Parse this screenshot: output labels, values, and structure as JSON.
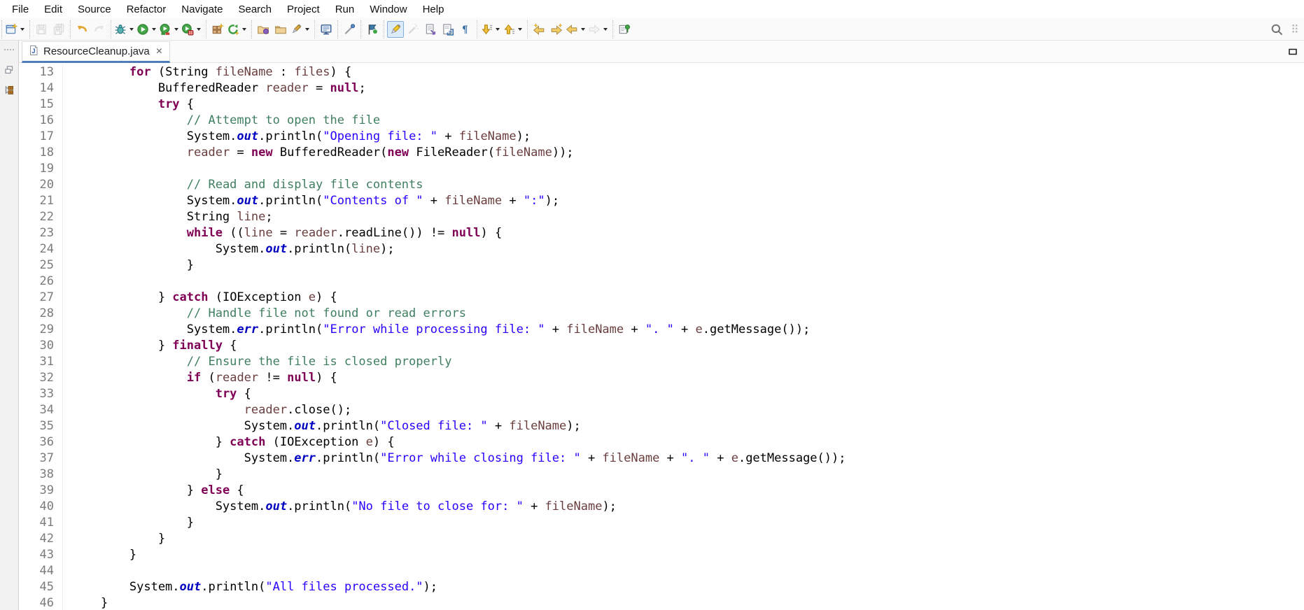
{
  "menubar": {
    "items": [
      {
        "label": "File"
      },
      {
        "label": "Edit"
      },
      {
        "label": "Source"
      },
      {
        "label": "Refactor"
      },
      {
        "label": "Navigate"
      },
      {
        "label": "Search"
      },
      {
        "label": "Project"
      },
      {
        "label": "Run"
      },
      {
        "label": "Window"
      },
      {
        "label": "Help"
      }
    ]
  },
  "toolbar": {
    "groups": [
      {
        "buttons": [
          {
            "name": "new-wizard",
            "icon": "new",
            "dd": true
          }
        ]
      },
      {
        "buttons": [
          {
            "name": "save",
            "icon": "save",
            "disabled": true
          },
          {
            "name": "save-all",
            "icon": "saveall",
            "disabled": true
          }
        ]
      },
      {
        "buttons": [
          {
            "name": "undo",
            "icon": "undo"
          },
          {
            "name": "redo",
            "icon": "redo",
            "disabled": true
          }
        ]
      },
      {
        "buttons": [
          {
            "name": "debug",
            "icon": "bug",
            "dd": true
          },
          {
            "name": "run",
            "icon": "play",
            "dd": true
          },
          {
            "name": "coverage",
            "icon": "cov",
            "dd": true
          },
          {
            "name": "profile",
            "icon": "prof",
            "dd": true
          }
        ]
      },
      {
        "buttons": [
          {
            "name": "new-java-project",
            "icon": "grid"
          },
          {
            "name": "run-last-tool",
            "icon": "refreshstar",
            "dd": true
          }
        ]
      },
      {
        "buttons": [
          {
            "name": "import-wizard",
            "icon": "folderp"
          },
          {
            "name": "open-resource",
            "icon": "folder"
          },
          {
            "name": "external-tools",
            "icon": "marker",
            "dd": true
          }
        ]
      },
      {
        "buttons": [
          {
            "name": "open-console",
            "icon": "monitor"
          }
        ]
      },
      {
        "buttons": [
          {
            "name": "inspect",
            "icon": "wand"
          }
        ]
      },
      {
        "buttons": [
          {
            "name": "next-task",
            "icon": "flag"
          }
        ]
      },
      {
        "buttons": [
          {
            "name": "mark-occurrences",
            "icon": "highlighter",
            "active": true
          },
          {
            "name": "content-assist",
            "icon": "pen2",
            "disabled": true
          },
          {
            "name": "open-task",
            "icon": "docarrow"
          },
          {
            "name": "show-source",
            "icon": "docframe"
          },
          {
            "name": "show-whitespace",
            "icon": "pilcrow"
          }
        ]
      },
      {
        "buttons": [
          {
            "name": "next-annotation",
            "icon": "arrdown",
            "dd": true
          },
          {
            "name": "previous-annotation",
            "icon": "arrup",
            "dd": true
          }
        ]
      },
      {
        "buttons": [
          {
            "name": "last-edit-location",
            "icon": "arrleftstar"
          },
          {
            "name": "next-edit-location",
            "icon": "arrrightstar"
          },
          {
            "name": "back",
            "icon": "arrleft",
            "dd": true
          },
          {
            "name": "forward",
            "icon": "arrright",
            "dd": true,
            "disabled": true
          }
        ]
      },
      {
        "buttons": [
          {
            "name": "pin-editor",
            "icon": "pin"
          }
        ]
      }
    ],
    "right": [
      {
        "name": "search",
        "icon": "search"
      },
      {
        "name": "toolbar-overflow",
        "icon": "dots"
      }
    ]
  },
  "left_rail": {
    "items": [
      {
        "name": "toolbar-handle",
        "icon": "raildots",
        "interactable": false
      },
      {
        "name": "restore-view",
        "icon": "railrestore",
        "interactable": true
      },
      {
        "name": "package-explorer",
        "icon": "railpackage",
        "interactable": true
      }
    ]
  },
  "editor": {
    "tab": {
      "label": "ResourceCleanup.java",
      "close_glyph": "×"
    },
    "colors": {
      "keyword": "#7f0055",
      "string": "#2a00ff",
      "comment": "#3f7f5f",
      "static_field": "#0000c0",
      "variable": "#6a3e3e",
      "plain": "#000000",
      "line_number": "#7b7b7b",
      "tab_underline": "#4f7cbe"
    },
    "code": {
      "language": "java",
      "lines": [
        {
          "n": 13,
          "tokens": [
            [
              "p",
              "        "
            ],
            [
              "k",
              "for"
            ],
            [
              "p",
              " (String "
            ],
            [
              "v",
              "fileName"
            ],
            [
              "p",
              " : "
            ],
            [
              "v",
              "files"
            ],
            [
              "p",
              ") {"
            ]
          ]
        },
        {
          "n": 14,
          "tokens": [
            [
              "p",
              "            BufferedReader "
            ],
            [
              "v",
              "reader"
            ],
            [
              "p",
              " = "
            ],
            [
              "k",
              "null"
            ],
            [
              "p",
              ";"
            ]
          ]
        },
        {
          "n": 15,
          "tokens": [
            [
              "p",
              "            "
            ],
            [
              "k",
              "try"
            ],
            [
              "p",
              " {"
            ]
          ]
        },
        {
          "n": 16,
          "tokens": [
            [
              "p",
              "                "
            ],
            [
              "c",
              "// Attempt to open the file"
            ]
          ]
        },
        {
          "n": 17,
          "tokens": [
            [
              "p",
              "                System."
            ],
            [
              "f",
              "out"
            ],
            [
              "p",
              ".println("
            ],
            [
              "s",
              "\"Opening file: \""
            ],
            [
              "p",
              " + "
            ],
            [
              "v",
              "fileName"
            ],
            [
              "p",
              ");"
            ]
          ]
        },
        {
          "n": 18,
          "tokens": [
            [
              "p",
              "                "
            ],
            [
              "v",
              "reader"
            ],
            [
              "p",
              " = "
            ],
            [
              "k",
              "new"
            ],
            [
              "p",
              " BufferedReader("
            ],
            [
              "k",
              "new"
            ],
            [
              "p",
              " FileReader("
            ],
            [
              "v",
              "fileName"
            ],
            [
              "p",
              "));"
            ]
          ]
        },
        {
          "n": 19,
          "tokens": []
        },
        {
          "n": 20,
          "tokens": [
            [
              "p",
              "                "
            ],
            [
              "c",
              "// Read and display file contents"
            ]
          ]
        },
        {
          "n": 21,
          "tokens": [
            [
              "p",
              "                System."
            ],
            [
              "f",
              "out"
            ],
            [
              "p",
              ".println("
            ],
            [
              "s",
              "\"Contents of \""
            ],
            [
              "p",
              " + "
            ],
            [
              "v",
              "fileName"
            ],
            [
              "p",
              " + "
            ],
            [
              "s",
              "\":\""
            ],
            [
              "p",
              ");"
            ]
          ]
        },
        {
          "n": 22,
          "tokens": [
            [
              "p",
              "                String "
            ],
            [
              "v",
              "line"
            ],
            [
              "p",
              ";"
            ]
          ]
        },
        {
          "n": 23,
          "tokens": [
            [
              "p",
              "                "
            ],
            [
              "k",
              "while"
            ],
            [
              "p",
              " (("
            ],
            [
              "v",
              "line"
            ],
            [
              "p",
              " = "
            ],
            [
              "v",
              "reader"
            ],
            [
              "p",
              ".readLine()) != "
            ],
            [
              "k",
              "null"
            ],
            [
              "p",
              ") {"
            ]
          ]
        },
        {
          "n": 24,
          "tokens": [
            [
              "p",
              "                    System."
            ],
            [
              "f",
              "out"
            ],
            [
              "p",
              ".println("
            ],
            [
              "v",
              "line"
            ],
            [
              "p",
              ");"
            ]
          ]
        },
        {
          "n": 25,
          "tokens": [
            [
              "p",
              "                }"
            ]
          ]
        },
        {
          "n": 26,
          "tokens": []
        },
        {
          "n": 27,
          "tokens": [
            [
              "p",
              "            } "
            ],
            [
              "k",
              "catch"
            ],
            [
              "p",
              " (IOException "
            ],
            [
              "v",
              "e"
            ],
            [
              "p",
              ") {"
            ]
          ]
        },
        {
          "n": 28,
          "tokens": [
            [
              "p",
              "                "
            ],
            [
              "c",
              "// Handle file not found or read errors"
            ]
          ]
        },
        {
          "n": 29,
          "tokens": [
            [
              "p",
              "                System."
            ],
            [
              "f",
              "err"
            ],
            [
              "p",
              ".println("
            ],
            [
              "s",
              "\"Error while processing file: \""
            ],
            [
              "p",
              " + "
            ],
            [
              "v",
              "fileName"
            ],
            [
              "p",
              " + "
            ],
            [
              "s",
              "\". \""
            ],
            [
              "p",
              " + "
            ],
            [
              "v",
              "e"
            ],
            [
              "p",
              ".getMessage());"
            ]
          ]
        },
        {
          "n": 30,
          "tokens": [
            [
              "p",
              "            } "
            ],
            [
              "k",
              "finally"
            ],
            [
              "p",
              " {"
            ]
          ]
        },
        {
          "n": 31,
          "tokens": [
            [
              "p",
              "                "
            ],
            [
              "c",
              "// Ensure the file is closed properly"
            ]
          ]
        },
        {
          "n": 32,
          "tokens": [
            [
              "p",
              "                "
            ],
            [
              "k",
              "if"
            ],
            [
              "p",
              " ("
            ],
            [
              "v",
              "reader"
            ],
            [
              "p",
              " != "
            ],
            [
              "k",
              "null"
            ],
            [
              "p",
              ") {"
            ]
          ]
        },
        {
          "n": 33,
          "tokens": [
            [
              "p",
              "                    "
            ],
            [
              "k",
              "try"
            ],
            [
              "p",
              " {"
            ]
          ]
        },
        {
          "n": 34,
          "tokens": [
            [
              "p",
              "                        "
            ],
            [
              "v",
              "reader"
            ],
            [
              "p",
              ".close();"
            ]
          ]
        },
        {
          "n": 35,
          "tokens": [
            [
              "p",
              "                        System."
            ],
            [
              "f",
              "out"
            ],
            [
              "p",
              ".println("
            ],
            [
              "s",
              "\"Closed file: \""
            ],
            [
              "p",
              " + "
            ],
            [
              "v",
              "fileName"
            ],
            [
              "p",
              ");"
            ]
          ]
        },
        {
          "n": 36,
          "tokens": [
            [
              "p",
              "                    } "
            ],
            [
              "k",
              "catch"
            ],
            [
              "p",
              " (IOException "
            ],
            [
              "v",
              "e"
            ],
            [
              "p",
              ") {"
            ]
          ]
        },
        {
          "n": 37,
          "tokens": [
            [
              "p",
              "                        System."
            ],
            [
              "f",
              "err"
            ],
            [
              "p",
              ".println("
            ],
            [
              "s",
              "\"Error while closing file: \""
            ],
            [
              "p",
              " + "
            ],
            [
              "v",
              "fileName"
            ],
            [
              "p",
              " + "
            ],
            [
              "s",
              "\". \""
            ],
            [
              "p",
              " + "
            ],
            [
              "v",
              "e"
            ],
            [
              "p",
              ".getMessage());"
            ]
          ]
        },
        {
          "n": 38,
          "tokens": [
            [
              "p",
              "                    }"
            ]
          ]
        },
        {
          "n": 39,
          "tokens": [
            [
              "p",
              "                } "
            ],
            [
              "k",
              "else"
            ],
            [
              "p",
              " {"
            ]
          ]
        },
        {
          "n": 40,
          "tokens": [
            [
              "p",
              "                    System."
            ],
            [
              "f",
              "out"
            ],
            [
              "p",
              ".println("
            ],
            [
              "s",
              "\"No file to close for: \""
            ],
            [
              "p",
              " + "
            ],
            [
              "v",
              "fileName"
            ],
            [
              "p",
              ");"
            ]
          ]
        },
        {
          "n": 41,
          "tokens": [
            [
              "p",
              "                }"
            ]
          ]
        },
        {
          "n": 42,
          "tokens": [
            [
              "p",
              "            }"
            ]
          ]
        },
        {
          "n": 43,
          "tokens": [
            [
              "p",
              "        }"
            ]
          ]
        },
        {
          "n": 44,
          "tokens": []
        },
        {
          "n": 45,
          "tokens": [
            [
              "p",
              "        System."
            ],
            [
              "f",
              "out"
            ],
            [
              "p",
              ".println("
            ],
            [
              "s",
              "\"All files processed.\""
            ],
            [
              "p",
              ");"
            ]
          ]
        },
        {
          "n": 46,
          "tokens": [
            [
              "p",
              "    }"
            ]
          ]
        }
      ]
    }
  }
}
